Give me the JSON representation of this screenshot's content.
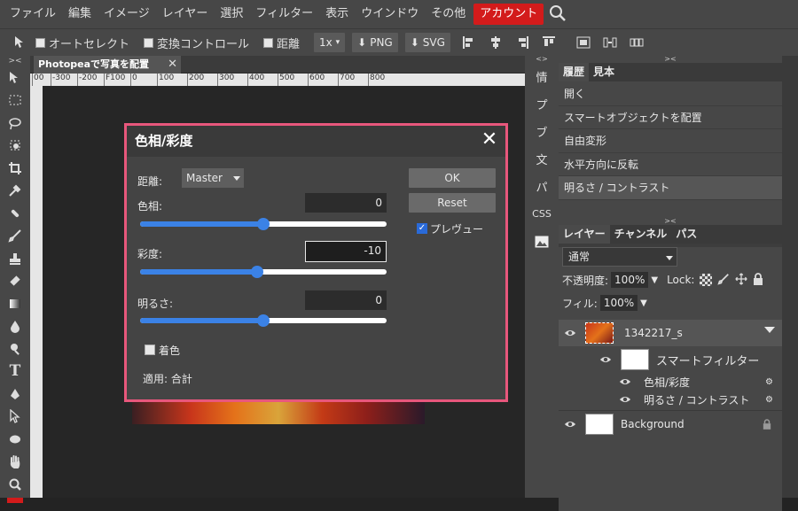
{
  "menubar": {
    "items": [
      "ファイル",
      "編集",
      "イメージ",
      "レイヤー",
      "選択",
      "フィルター",
      "表示",
      "ウインドウ",
      "その他"
    ],
    "account": "アカウント",
    "search_icon": "search-icon"
  },
  "options": {
    "auto_select": "オートセレクト",
    "transform": "変換コントロール",
    "distance": "距離",
    "scale": "1x",
    "png": "PNG",
    "svg": "SVG"
  },
  "document": {
    "tab_title": "Photopeaで写真を配置",
    "close": "✕",
    "ruler_ticks": [
      "00",
      "-300",
      "-200",
      "F100",
      "0",
      "100",
      "200",
      "300",
      "400",
      "500",
      "600",
      "700",
      "800"
    ]
  },
  "right_strip": {
    "items": [
      "情",
      "プ",
      "ブ",
      "文",
      "パ",
      "CSS"
    ]
  },
  "history_panel": {
    "tabs": [
      "履歴",
      "見本"
    ],
    "items": [
      "開く",
      "スマートオブジェクトを配置",
      "自由変形",
      "水平方向に反転",
      "明るさ / コントラスト"
    ]
  },
  "layers_panel": {
    "tabs": [
      "レイヤー",
      "チャンネル",
      "パス"
    ],
    "blend_mode": "通常",
    "opacity_label": "不透明度:",
    "opacity_value": "100%",
    "lock_label": "Lock:",
    "fill_label": "フィル:",
    "fill_value": "100%",
    "layers": {
      "photo": "1342217_s",
      "smart_filter": "スマートフィルター",
      "filter1": "色相/彩度",
      "filter2": "明るさ / コントラスト",
      "background": "Background"
    }
  },
  "dialog": {
    "title": "色相/彩度",
    "range_label": "距離:",
    "range_value": "Master",
    "hue_label": "色相:",
    "hue_value": "0",
    "hue_level": 0.5,
    "sat_label": "彩度:",
    "sat_value": "-10",
    "sat_level": 0.475,
    "light_label": "明るさ:",
    "light_value": "0",
    "light_level": 0.5,
    "colorize_label": "着色",
    "apply_label": "適用: 合計",
    "ok": "OK",
    "reset": "Reset",
    "preview": "プレヴュー",
    "preview_checked": "✓"
  },
  "colors": {
    "accent": "#3b82e6",
    "dialog_border": "#e8577c",
    "account_bg": "#d31b1b"
  }
}
